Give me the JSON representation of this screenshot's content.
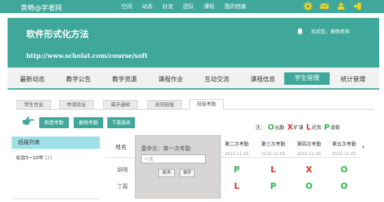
{
  "topbar": {
    "brand": "黄畅@学者网",
    "nav": [
      "空间",
      "动态",
      "好友",
      "团队",
      "课程",
      "我的档案"
    ],
    "icons": [
      "gear-icon",
      "mail-icon",
      "upload-icon",
      "logout-icon"
    ]
  },
  "header": {
    "title": "软件形式化方法",
    "url": "http://www.scholat.com/course/soft",
    "welcome": "欢迎您，黄畅老师"
  },
  "mainnav": {
    "items": [
      "最新动态",
      "教学公告",
      "教学资源",
      "课程作业",
      "互动交流",
      "课程信息",
      "学生管理",
      "统计管理"
    ],
    "active": "学生管理"
  },
  "subtabs": {
    "items": [
      "学生信息",
      "申请验证",
      "离开通知",
      "关闭班级",
      "班级考勤"
    ],
    "active": "班级考勤"
  },
  "toolbar": {
    "new": "新建考勤",
    "delete": "删除考勤",
    "download": "下载报表"
  },
  "legend": {
    "note": "注：",
    "present_sym": "O",
    "present": "出勤",
    "absent_sym": "X",
    "absent": "旷课",
    "late_sym": "L",
    "late": "迟到",
    "leave_sym": "P",
    "leave": "请假"
  },
  "classlist": {
    "title": "班级列表",
    "item": "实验5~10年",
    "count": "[2]"
  },
  "table": {
    "name_header": "姓名",
    "columns": [
      {
        "title": "第二次考勤",
        "date": "2015-11-05"
      },
      {
        "title": "第三次考勤",
        "date": "2015-11-05"
      },
      {
        "title": "第四次考勤",
        "date": "2015-11-05"
      },
      {
        "title": "第五次考勤",
        "date": "2015-11-05"
      }
    ],
    "rows": [
      {
        "name": "胡晓",
        "marks": [
          "P",
          "L",
          "X",
          "O"
        ]
      },
      {
        "name": "丁磊",
        "marks": [
          "L",
          "P",
          "O",
          "O"
        ]
      }
    ]
  },
  "popup": {
    "title": "重命名：第一次考勤",
    "input_value": "一次",
    "cancel": "取消",
    "save": "保存"
  },
  "colors": {
    "teal": "#3fa89a",
    "present": "#2fb84a",
    "absent": "#e0302a",
    "late": "#e0302a",
    "leave": "#2fb84a"
  }
}
